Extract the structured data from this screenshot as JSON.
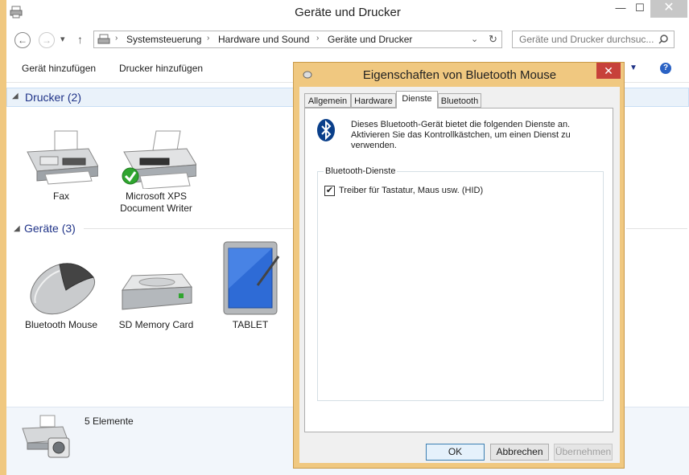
{
  "window": {
    "title": "Geräte und Drucker",
    "minimize": "—",
    "maximize": "☐",
    "close": "✕"
  },
  "nav": {
    "back": "←",
    "forward": "→",
    "dropdown": "▾",
    "up": "↑",
    "breadcrumb": [
      "Systemsteuerung",
      "Hardware und Sound",
      "Geräte und Drucker"
    ],
    "refresh": "↻",
    "search_placeholder": "Geräte und Drucker durchsuc..."
  },
  "toolbar": {
    "add_device": "Gerät hinzufügen",
    "add_printer": "Drucker hinzufügen",
    "help": "?"
  },
  "groups": {
    "printers": "Drucker (2)",
    "devices": "Geräte (3)"
  },
  "printers": [
    {
      "label": "Fax"
    },
    {
      "label": "Microsoft XPS Document Writer"
    }
  ],
  "devices": [
    {
      "label": "Bluetooth Mouse"
    },
    {
      "label": "SD Memory Card"
    },
    {
      "label": "TABLET"
    }
  ],
  "status": {
    "count": "5 Elemente"
  },
  "dialog": {
    "title": "Eigenschaften von Bluetooth Mouse",
    "close": "✕",
    "tabs": [
      "Allgemein",
      "Hardware",
      "Dienste",
      "Bluetooth"
    ],
    "active_tab": "Dienste",
    "description": "Dieses Bluetooth-Gerät bietet die folgenden Dienste an. Aktivieren Sie das Kontrollkästchen, um einen Dienst zu verwenden.",
    "group_label": "Bluetooth-Dienste",
    "service": {
      "label": "Treiber für Tastatur, Maus usw. (HID)",
      "checked": "✔"
    },
    "buttons": {
      "ok": "OK",
      "cancel": "Abbrechen",
      "apply": "Übernehmen"
    }
  },
  "colors": {
    "dialog_frame": "#f0c880",
    "close_red": "#c7413a",
    "group_blue": "#1e3287",
    "bluetooth_blue": "#0a3f8a"
  }
}
